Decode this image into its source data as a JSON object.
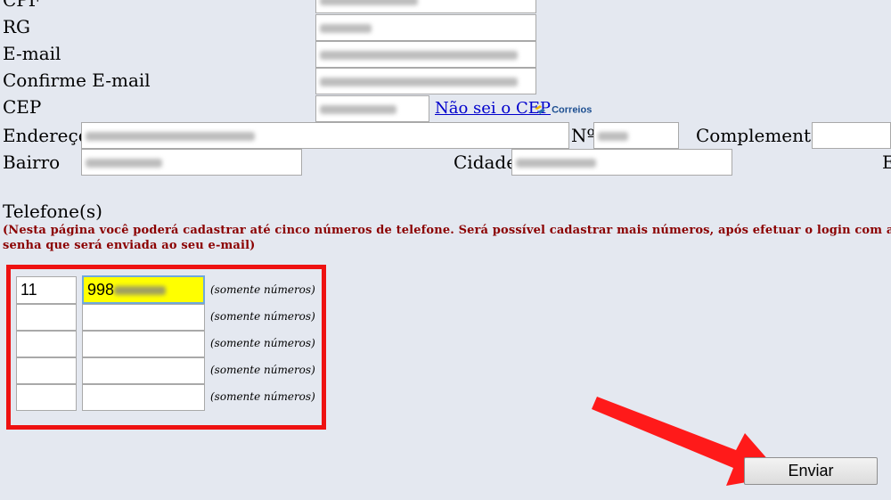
{
  "labels": {
    "cpf": "CPF",
    "rg": "RG",
    "email": "E-mail",
    "confirm_email": "Confirme E-mail",
    "cep": "CEP",
    "endereco": "Endereço",
    "numero": "Nº",
    "complemento": "Complemento",
    "bairro": "Bairro",
    "cidade": "Cidade",
    "extra": "E"
  },
  "cep_link": "Não sei o CEP",
  "correios_logo": "Correios",
  "telefones": {
    "heading": "Telefone(s)",
    "notice_line1": "(Nesta página você poderá cadastrar até cinco números de telefone. Será possível cadastrar mais números, após efetuar o login com a",
    "notice_line2": "senha que será enviada ao seu e-mail)",
    "hint": "(somente números)",
    "rows": [
      {
        "ddd": "11",
        "number": "998"
      },
      {
        "ddd": "",
        "number": ""
      },
      {
        "ddd": "",
        "number": ""
      },
      {
        "ddd": "",
        "number": ""
      },
      {
        "ddd": "",
        "number": ""
      }
    ]
  },
  "submit_label": "Enviar",
  "colors": {
    "background": "#e4e8f0",
    "highlight_box": "#ee1111",
    "notice_text": "#8b0000",
    "active_field": "#ffff00",
    "link": "#0000cc"
  }
}
